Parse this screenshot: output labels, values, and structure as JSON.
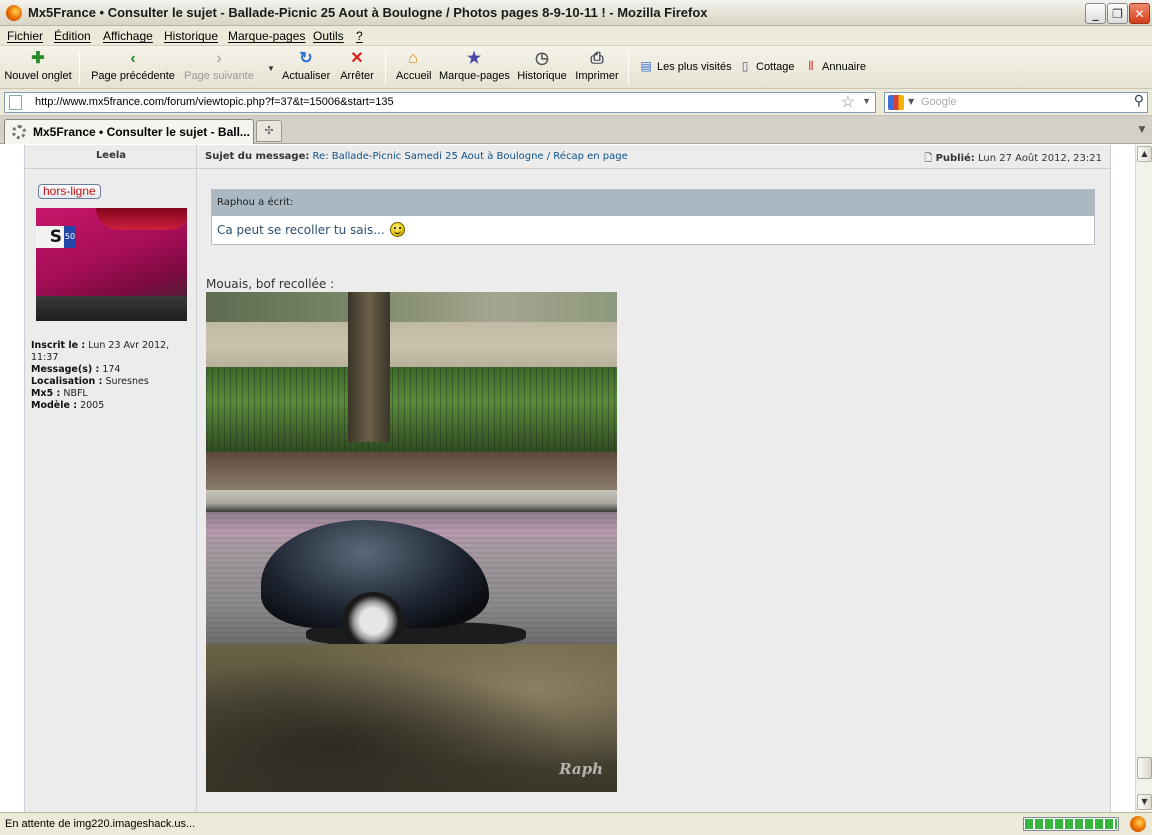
{
  "window": {
    "title": "Mx5France • Consulter le sujet - Ballade-Picnic 25 Aout à Boulogne / Photos pages 8-9-10-11 ! - Mozilla Firefox"
  },
  "menu": [
    "Fichier",
    "Édition",
    "Affichage",
    "Historique",
    "Marque-pages",
    "Outils",
    "?"
  ],
  "toolbar": {
    "new_tab": "Nouvel onglet",
    "back": "Page précédente",
    "forward": "Page suivante",
    "reload": "Actualiser",
    "stop": "Arrêter",
    "home": "Accueil",
    "bookmarks": "Marque-pages",
    "history": "Historique",
    "print": "Imprimer"
  },
  "bookmarks_bar": [
    "Les plus visités",
    "Cottage",
    "Annuaire"
  ],
  "address": {
    "url": "http://www.mx5france.com/forum/viewtopic.php?f=37&t=15006&start=135"
  },
  "search": {
    "placeholder": "Google"
  },
  "tabs": [
    {
      "label": "Mx5France • Consulter le sujet - Ball...",
      "loading": true
    }
  ],
  "post": {
    "author": "Leela",
    "status_badge": "hors-ligne",
    "profile": [
      {
        "label": "Inscrit le :",
        "value": "Lun 23 Avr 2012, 11:37"
      },
      {
        "label": "Message(s) :",
        "value": "174"
      },
      {
        "label": "Localisation :",
        "value": "Suresnes"
      },
      {
        "label": "Mx5 :",
        "value": "NBFL"
      },
      {
        "label": "Modèle :",
        "value": "2005"
      }
    ],
    "subject_label": "Sujet du message:",
    "subject": "Re: Ballade-Picnic Samedi 25 Aout à Boulogne / Récap en page",
    "published_label": "Publié:",
    "published": "Lun 27 Août 2012, 23:21",
    "quote_author": "Raphou a écrit:",
    "quote_text": "Ca peut se recoller tu sais...",
    "body_text": "Mouais, bof recollée :",
    "photo_watermark": "Raph",
    "avatar_plate": "S",
    "avatar_plate_num": "50"
  },
  "status": {
    "text": "En attente de img220.imageshack.us...",
    "progress": 1.0
  },
  "colors": {
    "link": "#105289",
    "offline": "#c61010",
    "quote_header": "#a9b8c2",
    "progress": "#37b43a"
  }
}
